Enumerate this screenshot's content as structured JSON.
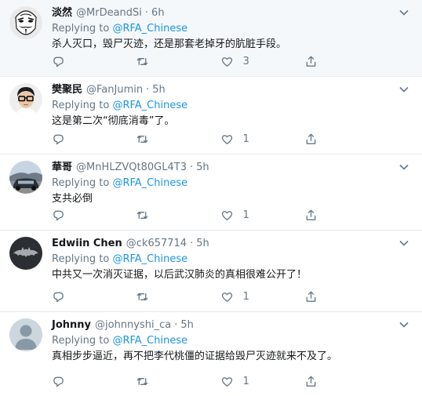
{
  "tweets": [
    {
      "name": "淡然",
      "handle": "@MrDeandSi",
      "time": "6h",
      "replying_prefix": "Replying to",
      "replying_to": "@RFA_Chinese",
      "text": "杀人灭口，毁尸灭迹，还是那套老掉牙的肮脏手段。",
      "reply_count": "",
      "retweet_count": "",
      "like_count": "3",
      "avatar_icon": "guy-fawkes-mask-avatar"
    },
    {
      "name": "樊聚民",
      "handle": "@FanJumin",
      "time": "5h",
      "replying_prefix": "Replying to",
      "replying_to": "@RFA_Chinese",
      "text": "这是第二次“彻底消毒”了。",
      "reply_count": "",
      "retweet_count": "",
      "like_count": "1",
      "avatar_icon": "man-with-glasses-avatar"
    },
    {
      "name": "華哥",
      "handle": "@MnHLZVQt80GL4T3",
      "time": "5h",
      "replying_prefix": "Replying to",
      "replying_to": "@RFA_Chinese",
      "text": "支共必倒",
      "reply_count": "",
      "retweet_count": "",
      "like_count": "1",
      "avatar_icon": "car-photo-avatar"
    },
    {
      "name": "Edwiin Chen",
      "handle": "@ck657714",
      "time": "5h",
      "replying_prefix": "Replying to",
      "replying_to": "@RFA_Chinese",
      "text": "中共又一次消灭证据，以后武汉肺炎的真相很难公开了！",
      "reply_count": "",
      "retweet_count": "",
      "like_count": "1",
      "avatar_icon": "bat-logo-avatar"
    },
    {
      "name": "Johnny",
      "handle": "@johnnyshi_ca",
      "time": "5h",
      "replying_prefix": "Replying to",
      "replying_to": "@RFA_Chinese",
      "text": "真相步步逼近，再不把李代桃僵的证据给毁尸灭迹就来不及了。",
      "reply_count": "",
      "retweet_count": "",
      "like_count": "1",
      "avatar_icon": "default-profile-avatar"
    }
  ],
  "colors": {
    "link": "#1b95e0",
    "secondary_text": "#657786",
    "primary_text": "#14171a",
    "highlight_bg": "#f5f8fa",
    "divider": "#e6ecf0"
  }
}
